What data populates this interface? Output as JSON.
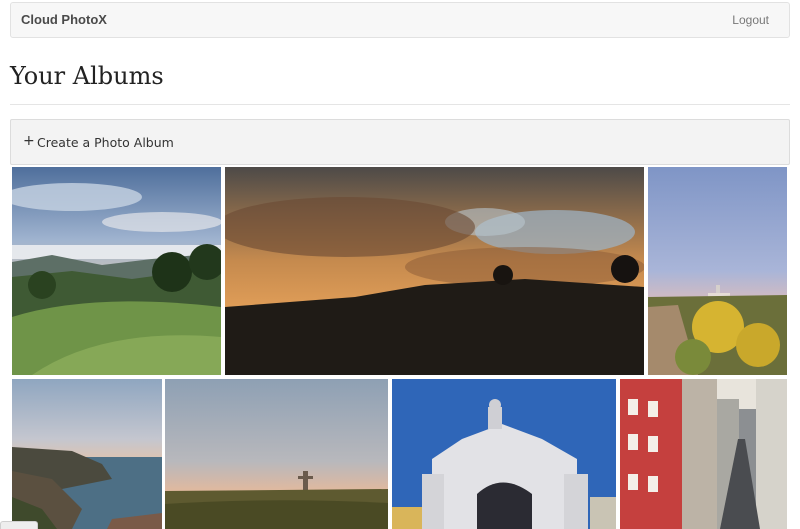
{
  "navbar": {
    "brand": "Cloud PhotoX",
    "logout_label": "Logout"
  },
  "page": {
    "title": "Your Albums"
  },
  "create_album": {
    "icon": "plus-icon",
    "plus_glyph": "+",
    "label": "Create a Photo Album"
  },
  "albums": [
    {
      "subject": "hillside meadow with trees under pastel sky"
    },
    {
      "subject": "orange sunset clouds over dark hill"
    },
    {
      "subject": "lighthouse on hill with yellow flowers"
    },
    {
      "subject": "coastal cliffs and sea at dusk"
    },
    {
      "subject": "monument on hill at twilight"
    },
    {
      "subject": "ornate white triumphal arch"
    },
    {
      "subject": "narrow city street with colorful buildings"
    }
  ]
}
